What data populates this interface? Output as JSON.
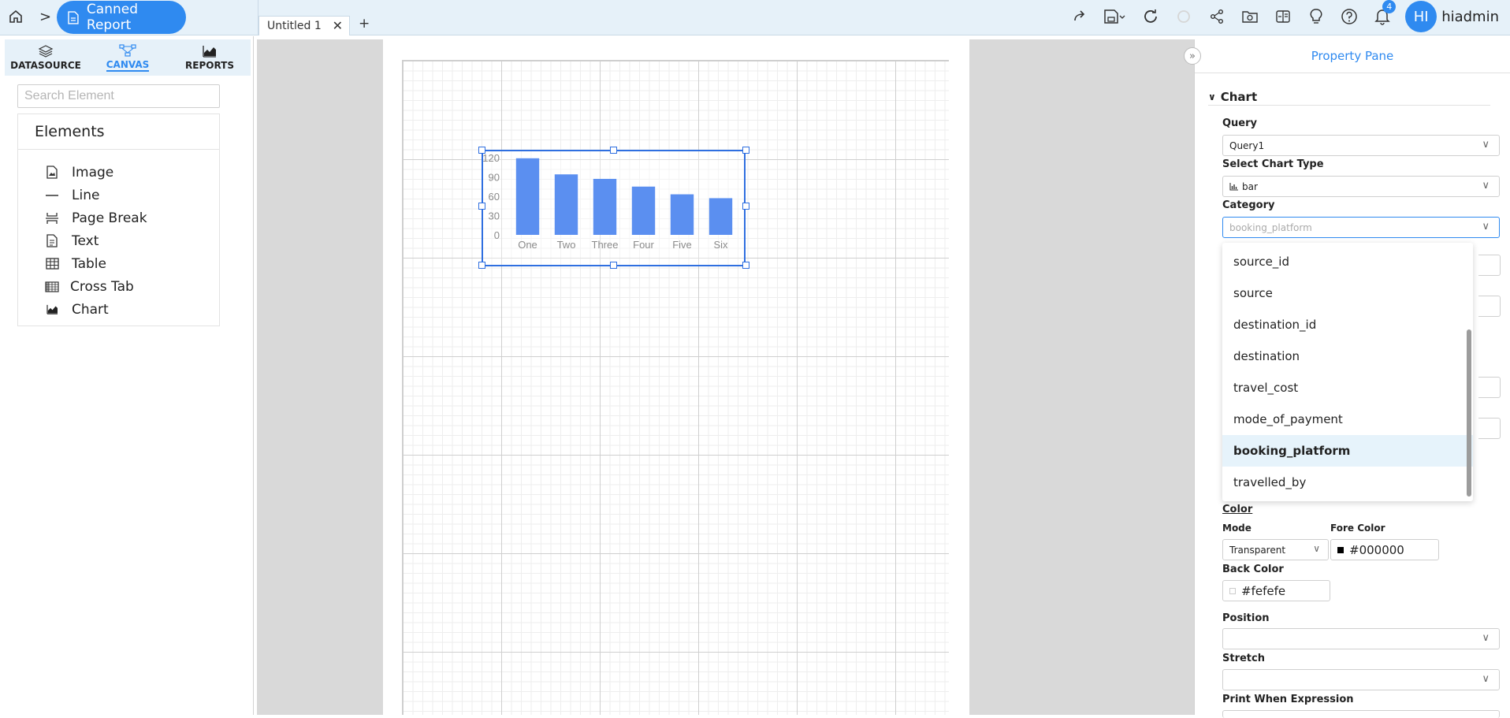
{
  "header": {
    "crumb_label": "Canned Report",
    "tab_label": "Untitled 1",
    "add_tab": "+",
    "notification_count": "4",
    "user_initials": "HI",
    "user_name": "hiadmin"
  },
  "left_tabs": [
    {
      "label": "DATASOURCE",
      "icon": "datasource-icon"
    },
    {
      "label": "CANVAS",
      "icon": "canvas-icon",
      "active": true
    },
    {
      "label": "REPORTS",
      "icon": "reports-icon"
    }
  ],
  "search": {
    "placeholder": "Search Element"
  },
  "elements": {
    "title": "Elements",
    "items": [
      {
        "label": "Image",
        "icon": "image-icon"
      },
      {
        "label": "Line",
        "icon": "line-icon"
      },
      {
        "label": "Page Break",
        "icon": "page-break-icon"
      },
      {
        "label": "Text",
        "icon": "text-icon"
      },
      {
        "label": "Table",
        "icon": "table-icon"
      },
      {
        "label": "Cross Tab",
        "icon": "cross-tab-icon"
      },
      {
        "label": "Chart",
        "icon": "chart-icon"
      }
    ]
  },
  "chart_data": {
    "type": "bar",
    "categories": [
      "One",
      "Two",
      "Three",
      "Four",
      "Five",
      "Six"
    ],
    "values": [
      119,
      94,
      87,
      75,
      63,
      57
    ],
    "y_ticks": [
      "0",
      "30",
      "60",
      "90",
      "120"
    ],
    "ylim": [
      0,
      120
    ],
    "color": "#5b8ff0",
    "grid": false
  },
  "pane": {
    "title": "Property Pane",
    "section": "Chart",
    "query_label": "Query",
    "query_value": "Query1",
    "chart_type_label": "Select Chart Type",
    "chart_type_value": "bar",
    "category_label": "Category",
    "category_placeholder": "booking_platform",
    "dropdown_options": [
      "source_id",
      "source",
      "destination_id",
      "destination",
      "travel_cost",
      "mode_of_payment",
      "booking_platform",
      "travelled_by"
    ],
    "selected_option": "booking_platform",
    "color_label": "Color",
    "mode_label": "Mode",
    "mode_value": "Transparent",
    "fore_color_label": "Fore Color",
    "fore_color_value": "#000000",
    "back_color_label": "Back Color",
    "back_color_value": "#fefefe",
    "position_label": "Position",
    "stretch_label": "Stretch",
    "print_when_label": "Print When Expression"
  },
  "colors": {
    "accent": "#2f8af0",
    "topbar": "#e6f1f9",
    "bar": "#5b8ff0"
  }
}
